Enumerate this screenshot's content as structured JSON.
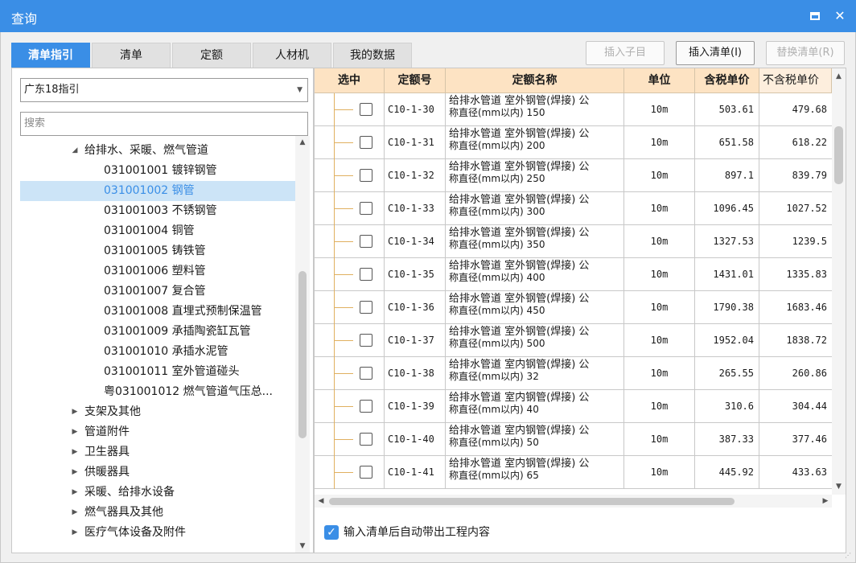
{
  "window": {
    "title": "查询",
    "colors": {
      "accent": "#3a8ee6",
      "header_bg": "#fde3c3",
      "selected_bg": "#cce4f7"
    }
  },
  "tabs": [
    {
      "label": "清单指引",
      "active": true
    },
    {
      "label": "清单",
      "active": false
    },
    {
      "label": "定额",
      "active": false
    },
    {
      "label": "人材机",
      "active": false
    },
    {
      "label": "我的数据",
      "active": false
    }
  ],
  "toolbar": {
    "insert_child": "插入子目",
    "insert_list": "插入清单(I)",
    "replace_list": "替换清单(R)"
  },
  "left": {
    "dropdown_value": "广东18指引",
    "search_placeholder": "搜索",
    "tree": [
      {
        "label": "给排水、采暖、燃气管道",
        "expanded": true,
        "level": 1
      },
      {
        "label": "031001001  镀锌钢管",
        "level": 2
      },
      {
        "label": "031001002  钢管",
        "level": 2,
        "selected": true
      },
      {
        "label": "031001003  不锈钢管",
        "level": 2
      },
      {
        "label": "031001004  铜管",
        "level": 2
      },
      {
        "label": "031001005  铸铁管",
        "level": 2
      },
      {
        "label": "031001006  塑料管",
        "level": 2
      },
      {
        "label": "031001007  复合管",
        "level": 2
      },
      {
        "label": "031001008  直埋式预制保温管",
        "level": 2
      },
      {
        "label": "031001009  承插陶瓷缸瓦管",
        "level": 2
      },
      {
        "label": "031001010  承插水泥管",
        "level": 2
      },
      {
        "label": "031001011  室外管道碰头",
        "level": 2
      },
      {
        "label": "粤031001012  燃气管道气压总...",
        "level": 2
      },
      {
        "label": "支架及其他",
        "expanded": false,
        "level": 1
      },
      {
        "label": "管道附件",
        "expanded": false,
        "level": 1
      },
      {
        "label": "卫生器具",
        "expanded": false,
        "level": 1
      },
      {
        "label": "供暖器具",
        "expanded": false,
        "level": 1
      },
      {
        "label": "采暖、给排水设备",
        "expanded": false,
        "level": 1
      },
      {
        "label": "燃气器具及其他",
        "expanded": false,
        "level": 1
      },
      {
        "label": "医疗气体设备及附件",
        "expanded": false,
        "level": 1
      }
    ]
  },
  "grid": {
    "headers": [
      "选中",
      "定额号",
      "定额名称",
      "单位",
      "含税单价",
      "不含税单价"
    ],
    "rows": [
      {
        "code": "C10-1-30",
        "name1": "给排水管道 室外钢管(焊接) 公",
        "name2": "称直径(mm以内) 150",
        "unit": "10m",
        "price_tax": "503.61",
        "price_notax": "479.68"
      },
      {
        "code": "C10-1-31",
        "name1": "给排水管道 室外钢管(焊接) 公",
        "name2": "称直径(mm以内) 200",
        "unit": "10m",
        "price_tax": "651.58",
        "price_notax": "618.22"
      },
      {
        "code": "C10-1-32",
        "name1": "给排水管道 室外钢管(焊接) 公",
        "name2": "称直径(mm以内) 250",
        "unit": "10m",
        "price_tax": "897.1",
        "price_notax": "839.79"
      },
      {
        "code": "C10-1-33",
        "name1": "给排水管道 室外钢管(焊接) 公",
        "name2": "称直径(mm以内) 300",
        "unit": "10m",
        "price_tax": "1096.45",
        "price_notax": "1027.52"
      },
      {
        "code": "C10-1-34",
        "name1": "给排水管道 室外钢管(焊接) 公",
        "name2": "称直径(mm以内) 350",
        "unit": "10m",
        "price_tax": "1327.53",
        "price_notax": "1239.5"
      },
      {
        "code": "C10-1-35",
        "name1": "给排水管道 室外钢管(焊接) 公",
        "name2": "称直径(mm以内) 400",
        "unit": "10m",
        "price_tax": "1431.01",
        "price_notax": "1335.83"
      },
      {
        "code": "C10-1-36",
        "name1": "给排水管道 室外钢管(焊接) 公",
        "name2": "称直径(mm以内) 450",
        "unit": "10m",
        "price_tax": "1790.38",
        "price_notax": "1683.46"
      },
      {
        "code": "C10-1-37",
        "name1": "给排水管道 室外钢管(焊接) 公",
        "name2": "称直径(mm以内) 500",
        "unit": "10m",
        "price_tax": "1952.04",
        "price_notax": "1838.72"
      },
      {
        "code": "C10-1-38",
        "name1": "给排水管道 室内钢管(焊接) 公",
        "name2": "称直径(mm以内) 32",
        "unit": "10m",
        "price_tax": "265.55",
        "price_notax": "260.86"
      },
      {
        "code": "C10-1-39",
        "name1": "给排水管道 室内钢管(焊接) 公",
        "name2": "称直径(mm以内) 40",
        "unit": "10m",
        "price_tax": "310.6",
        "price_notax": "304.44"
      },
      {
        "code": "C10-1-40",
        "name1": "给排水管道 室内钢管(焊接) 公",
        "name2": "称直径(mm以内) 50",
        "unit": "10m",
        "price_tax": "387.33",
        "price_notax": "377.46"
      },
      {
        "code": "C10-1-41",
        "name1": "给排水管道 室内钢管(焊接) 公",
        "name2": "称直径(mm以内) 65",
        "unit": "10m",
        "price_tax": "445.92",
        "price_notax": "433.63"
      }
    ]
  },
  "footer": {
    "auto_label": "输入清单后自动带出工程内容",
    "auto_checked": true
  }
}
